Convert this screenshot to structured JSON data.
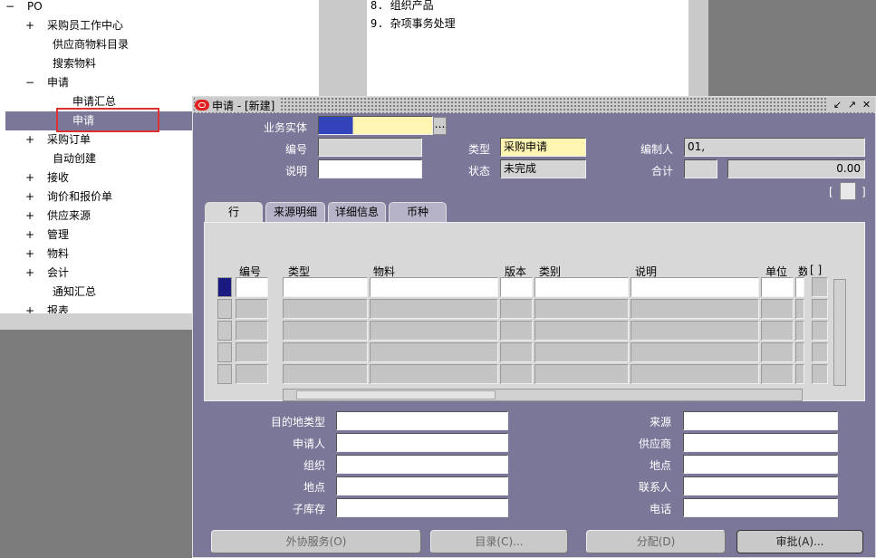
{
  "navigator": {
    "tree": [
      {
        "sign": "−",
        "label": "PO",
        "indent": 0
      },
      {
        "sign": "+",
        "label": "采购员工作中心",
        "indent": 1
      },
      {
        "sign": "",
        "label": "供应商物料目录",
        "indent": 2
      },
      {
        "sign": "",
        "label": "搜索物料",
        "indent": 2
      },
      {
        "sign": "−",
        "label": "申请",
        "indent": 1
      },
      {
        "sign": "",
        "label": "申请汇总",
        "indent": 3
      },
      {
        "sign": "",
        "label": "申请",
        "indent": 3
      },
      {
        "sign": "+",
        "label": "采购订单",
        "indent": 1
      },
      {
        "sign": "",
        "label": "自动创建",
        "indent": 2
      },
      {
        "sign": "+",
        "label": "接收",
        "indent": 1
      },
      {
        "sign": "+",
        "label": "询价和报价单",
        "indent": 1
      },
      {
        "sign": "+",
        "label": "供应来源",
        "indent": 1
      },
      {
        "sign": "+",
        "label": "管理",
        "indent": 1
      },
      {
        "sign": "+",
        "label": "物料",
        "indent": 1
      },
      {
        "sign": "+",
        "label": "会计",
        "indent": 1
      },
      {
        "sign": "",
        "label": "通知汇总",
        "indent": 2
      },
      {
        "sign": "+",
        "label": "报表",
        "indent": 1
      }
    ],
    "functions": [
      "8. 组织产品",
      "9. 杂项事务处理"
    ]
  },
  "window": {
    "title": "申请 - [新建]",
    "header": {
      "operating_unit_label": "业务实体",
      "operating_unit_value": "",
      "number_label": "编号",
      "number_value": "",
      "type_label": "类型",
      "type_value": "采购申请",
      "preparer_label": "编制人",
      "preparer_value": "01,",
      "description_label": "说明",
      "description_value": "",
      "status_label": "状态",
      "status_value": "未完成",
      "total_label": "合计",
      "total_currency": "",
      "total_value": "0.00"
    },
    "tabs": [
      "行",
      "来源明细",
      "详细信息",
      "币种"
    ],
    "columns": [
      "编号",
      "类型",
      "物料",
      "版本",
      "类别",
      "说明",
      "单位",
      "数"
    ],
    "bracket": "[ ]",
    "lower_left": [
      {
        "label": "目的地类型",
        "value": ""
      },
      {
        "label": "申请人",
        "value": ""
      },
      {
        "label": "组织",
        "value": ""
      },
      {
        "label": "地点",
        "value": ""
      },
      {
        "label": "子库存",
        "value": ""
      }
    ],
    "lower_right": [
      {
        "label": "来源",
        "value": ""
      },
      {
        "label": "供应商",
        "value": ""
      },
      {
        "label": "地点",
        "value": ""
      },
      {
        "label": "联系人",
        "value": ""
      },
      {
        "label": "电话",
        "value": ""
      }
    ],
    "buttons": {
      "outside_services": "外协服务(O)",
      "catalog": "目录(C)...",
      "distributions": "分配(D)",
      "approve": "审批(A)..."
    }
  }
}
